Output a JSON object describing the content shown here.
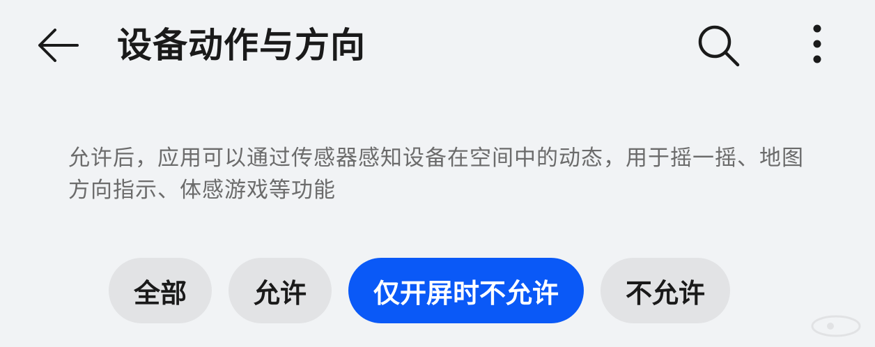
{
  "header": {
    "title": "设备动作与方向"
  },
  "description": "允许后，应用可以通过传感器感知设备在空间中的动态，用于摇一摇、地图方向指示、体感游戏等功能",
  "options": [
    {
      "label": "全部",
      "selected": false
    },
    {
      "label": "允许",
      "selected": false
    },
    {
      "label": "仅开屏时不允许",
      "selected": true
    },
    {
      "label": "不允许",
      "selected": false
    }
  ],
  "colors": {
    "background": "#f1f3f5",
    "accent": "#0a59f7",
    "chip": "#e2e3e5",
    "text": "#1a1a1a",
    "secondary_text": "#6b6b6b"
  },
  "icons": {
    "back": "arrow-left-icon",
    "search": "search-icon",
    "more": "more-vertical-icon"
  }
}
